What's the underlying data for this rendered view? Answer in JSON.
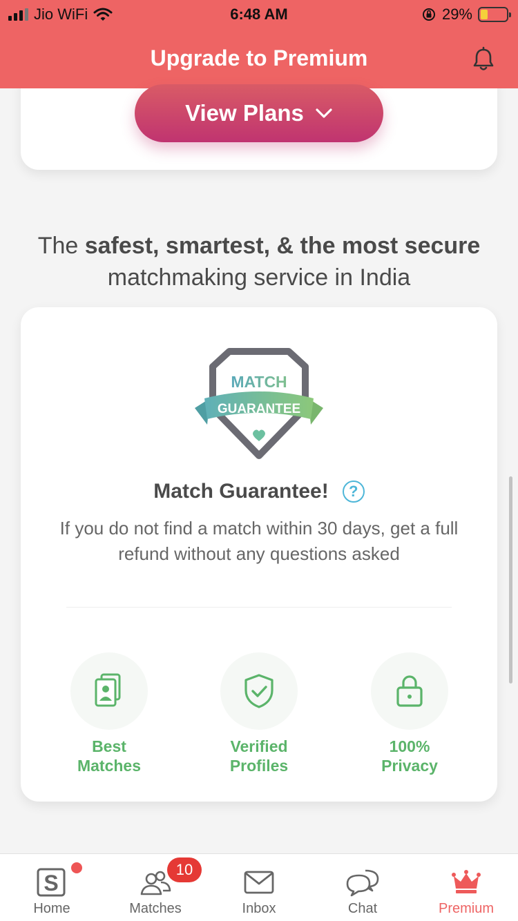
{
  "status_bar": {
    "carrier": "Jio WiFi",
    "time": "6:48 AM",
    "battery": "29%",
    "battery_level": 0.29
  },
  "header": {
    "title": "Upgrade to Premium"
  },
  "view_plans": {
    "label": "View Plans"
  },
  "tagline": {
    "part1": "The ",
    "bold1": "safest, smartest, & the most secure",
    "part2": " matchmaking service in India"
  },
  "match_guarantee": {
    "badge_top": "MATCH",
    "badge_ribbon": "GUARANTEE",
    "title": "Match Guarantee!",
    "help": "?",
    "description": "If you do not find a match within 30 days, get a full refund without any questions asked"
  },
  "features": [
    {
      "line1": "Best",
      "line2": "Matches",
      "icon": "profile-cards-icon"
    },
    {
      "line1": "Verified",
      "line2": "Profiles",
      "icon": "shield-check-icon"
    },
    {
      "line1": "100%",
      "line2": "Privacy",
      "icon": "lock-icon"
    }
  ],
  "bottom_nav": {
    "items": [
      {
        "label": "Home",
        "icon": "home-s-icon"
      },
      {
        "label": "Matches",
        "icon": "people-icon",
        "badge": "10"
      },
      {
        "label": "Inbox",
        "icon": "mail-icon"
      },
      {
        "label": "Chat",
        "icon": "chat-bubbles-icon"
      },
      {
        "label": "Premium",
        "icon": "crown-icon",
        "active": true
      }
    ]
  },
  "colors": {
    "header": "#ee6464",
    "button_gradient_start": "#d95b66",
    "button_gradient_end": "#c03470",
    "feature_green": "#5bb46a",
    "badge_red": "#e53935"
  }
}
